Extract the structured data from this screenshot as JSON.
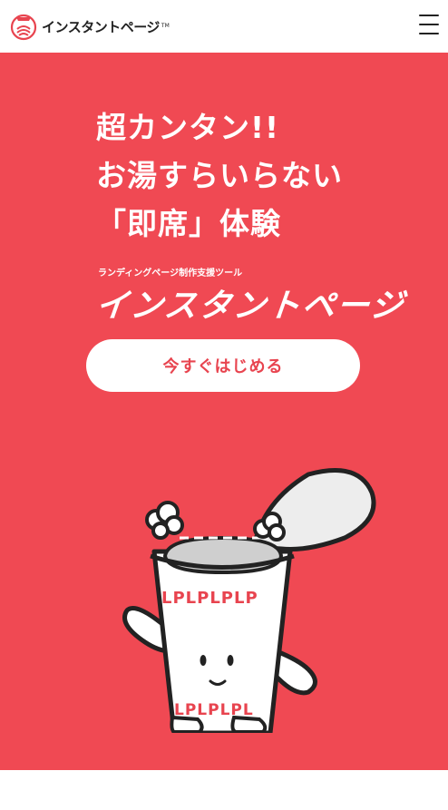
{
  "header": {
    "brand_name": "インスタントページ",
    "brand_tm": "TM",
    "menu_label": "menu"
  },
  "hero": {
    "headline_lines": [
      "超カンタン!!",
      "お湯すらいらない",
      "「即席」体験"
    ],
    "tagline": "ランディングページ制作支援ツール",
    "product_name": "インスタントページ",
    "cta_label": "今すぐはじめる",
    "cup_print_text": "LPLPLPLP",
    "cup_print_text_bottom": "LPLPLPL"
  },
  "colors": {
    "brand_red": "#f04953",
    "cta_text": "#e8444f",
    "white": "#ffffff",
    "ink": "#222222"
  },
  "icons": {
    "brand_logo": "instant-cup-logo-icon",
    "menu": "hamburger-menu-icon",
    "mascot": "cup-noodle-mascot-illustration"
  }
}
